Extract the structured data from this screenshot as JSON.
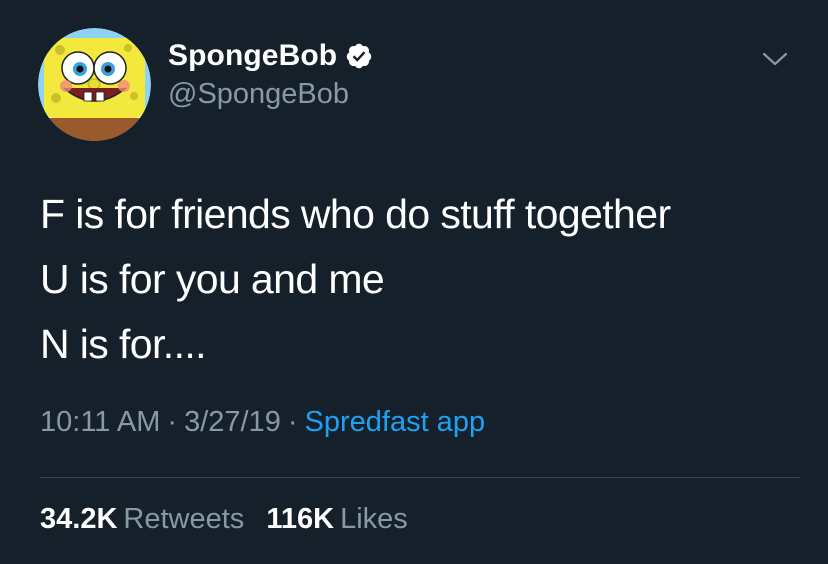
{
  "author": {
    "display_name": "SpongeBob",
    "handle": "@SpongeBob",
    "verified": true,
    "avatar_icon": "spongebob-avatar"
  },
  "tweet": {
    "lines": [
      "F is for friends who do stuff together",
      "U is for you and me",
      "N is for...."
    ]
  },
  "meta": {
    "time": "10:11 AM",
    "separator": "·",
    "date": "3/27/19",
    "source": "Spredfast app"
  },
  "stats": {
    "retweets_count": "34.2K",
    "retweets_label": "Retweets",
    "likes_count": "116K",
    "likes_label": "Likes"
  },
  "colors": {
    "background": "#15202b",
    "text": "#ffffff",
    "secondary": "#8899a6",
    "link": "#1da1f2",
    "divider": "#38444d"
  },
  "icons": {
    "verified": "verified-badge-icon",
    "menu": "chevron-down-icon"
  }
}
